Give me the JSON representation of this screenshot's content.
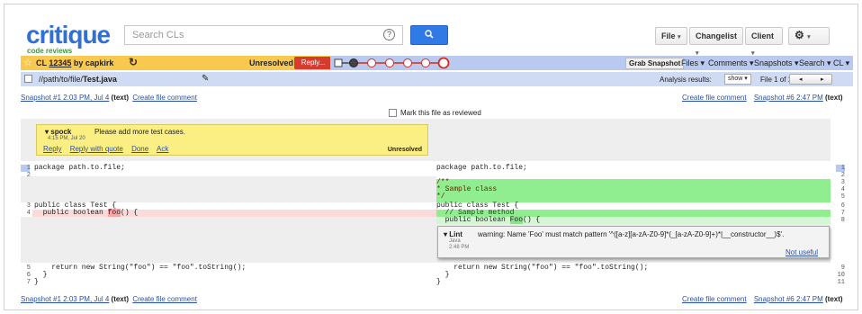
{
  "header": {
    "logo_text": "critique",
    "logo_tagline": "code reviews",
    "search_placeholder": "Search CLs",
    "help_glyph": "?",
    "search_icon": "search-icon",
    "file_label": "File",
    "changelist_label": "Changelist",
    "client_label": "Client",
    "settings_icon": "gear-icon"
  },
  "cl_bar": {
    "star": "☆",
    "cl_prefix": "CL",
    "cl_number": "12345",
    "by_author": "by capkirk",
    "status": "Unresolved",
    "reply_label": "Reply...",
    "grab_snapshot": "Grab Snapshot",
    "menus": [
      "Files",
      "Comments",
      "Snapshots",
      "Search",
      "CL"
    ]
  },
  "file_bar": {
    "path_prefix": "//path/to/file/",
    "filename": "Test.java",
    "analysis_label": "Analysis results:",
    "show_label": "show",
    "file_of": "File 1 of 1"
  },
  "snapshots": {
    "left": "Snapshot #1 2:03 PM, Jul 4",
    "left_tag": "(text)",
    "create_comment": "Create file comment",
    "right": "Snapshot #6 2:47 PM",
    "right_tag": "(text)"
  },
  "mark_reviewed": "Mark this file as reviewed",
  "comment": {
    "author": "▾ spock",
    "message": "Please add more test cases.",
    "time": "4:15 PM, Jul 20",
    "actions": [
      "Reply",
      "Reply with quote",
      "Done",
      "Ack"
    ],
    "status": "Unresolved"
  },
  "left_code": {
    "l1": "package path.to.file;",
    "l3": "public class Test {",
    "l4a": "  public boolean ",
    "l4b": "foo",
    "l4c": "() {",
    "l5": "    return new String(\"foo\") == \"foo\".toString();",
    "l6": "  }",
    "l7": "}",
    "nums": [
      "1",
      "2",
      "3",
      "4",
      "5",
      "6",
      "7"
    ]
  },
  "right_code": {
    "l1": "package path.to.file;",
    "l3": "/**",
    "l4": "* Sample class",
    "l5": "*/",
    "l6": "public class Test {",
    "l7": "  // Sample method",
    "l8a": "  public boolean ",
    "l8b": "Foo",
    "l8c": "() {",
    "l9": "    return new String(\"foo\") == \"foo\".toString();",
    "l10": "  }",
    "l11": "}",
    "nums": [
      "1",
      "2",
      "3",
      "4",
      "5",
      "6",
      "7",
      "8",
      "9",
      "10",
      "11"
    ]
  },
  "lint": {
    "author": "▾ Lint",
    "message": "warning: Name 'Foo' must match pattern '^([a-z][a-zA-Z0-9]*(_[a-zA-Z0-9]+)*|__constructor__)$'.",
    "source": "Java",
    "time": "2:48 PM",
    "action": "Not useful"
  }
}
